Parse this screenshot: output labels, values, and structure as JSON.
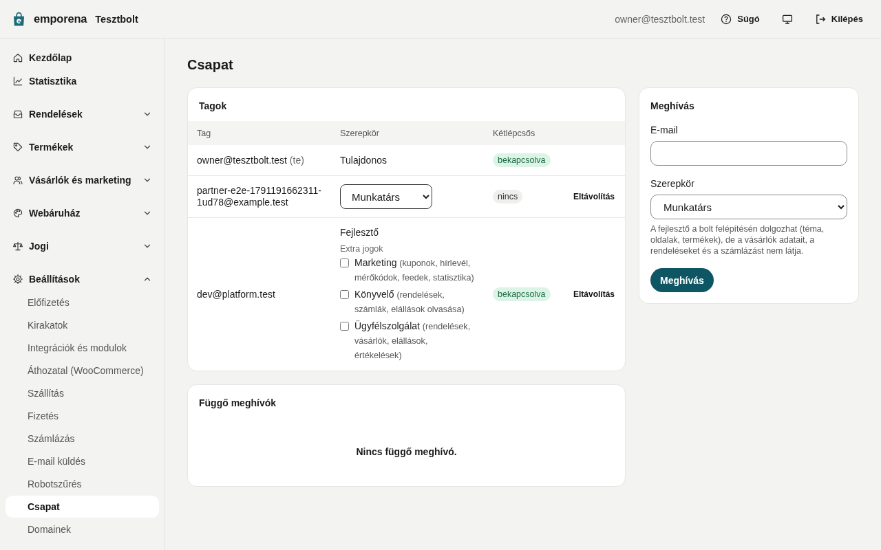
{
  "header": {
    "brand": "emporena",
    "store": "Tesztbolt",
    "user_email": "owner@tesztbolt.test",
    "actions": [
      {
        "kind": "help",
        "label": "Súgó"
      },
      {
        "kind": "display"
      },
      {
        "kind": "logout",
        "label": "Kilépés"
      }
    ]
  },
  "sidebar": {
    "items": [
      {
        "kind": "link",
        "label": "Kezdőlap",
        "selected": false
      },
      {
        "kind": "link",
        "label": "Statisztika",
        "selected": false
      },
      {
        "kind": "group",
        "label": "Rendelések",
        "expanded": false
      },
      {
        "kind": "group",
        "label": "Termékek",
        "expanded": false
      },
      {
        "kind": "group",
        "label": "Vásárlók és marketing",
        "expanded": false
      },
      {
        "kind": "group",
        "label": "Webáruház",
        "expanded": false
      },
      {
        "kind": "group",
        "label": "Jogi",
        "expanded": false
      },
      {
        "kind": "group",
        "label": "Beállítások",
        "expanded": true,
        "children": [
          {
            "label": "Előfizetés",
            "selected": false
          },
          {
            "label": "Kirakatok",
            "selected": false
          },
          {
            "label": "Integrációk és modulok",
            "selected": false
          },
          {
            "label": "Áthozatal (WooCommerce)",
            "selected": false
          },
          {
            "label": "Szállítás",
            "selected": false
          },
          {
            "label": "Fizetés",
            "selected": false
          },
          {
            "label": "Számlázás",
            "selected": false
          },
          {
            "label": "E-mail küldés",
            "selected": false
          },
          {
            "label": "Robotszűrés",
            "selected": false
          },
          {
            "label": "Csapat",
            "selected": true
          },
          {
            "label": "Domainek",
            "selected": false
          }
        ]
      }
    ]
  },
  "page": {
    "title": "Csapat"
  },
  "members": {
    "title": "Tagok",
    "columns": [
      "Tag",
      "Szerepkör",
      "Kétlépcsős"
    ],
    "rows": [
      {
        "member": "owner@tesztbolt.test",
        "member_note": "(te)",
        "role": {
          "kind": "text",
          "label": "Tulajdonos"
        },
        "two_factor": {
          "label": "bekapcsolva",
          "enabled": true
        }
      },
      {
        "member": "partner-e2e-1791191662311-1ud78@example.test",
        "role": {
          "kind": "select",
          "value": "Munkatárs"
        },
        "two_factor": {
          "label": "nincs",
          "enabled": false
        },
        "action": "Eltávolítás"
      },
      {
        "member": "dev@platform.test",
        "role": {
          "kind": "permissions",
          "label": "Fejlesztő",
          "extra_label": "Extra jogok",
          "permissions": [
            {
              "name": "Marketing",
              "detail": "(kuponok, hírlevél, mérőkódok, feedek, statisztika)",
              "checked": false
            },
            {
              "name": "Könyvelő",
              "detail": "(rendelések, számlák, elállások olvasása)",
              "checked": false
            },
            {
              "name": "Ügyfélszolgálat",
              "detail": "(rendelések, vásárlók, elállások, értékelések)",
              "checked": false
            }
          ]
        },
        "two_factor": {
          "label": "bekapcsolva",
          "enabled": true
        },
        "action": "Eltávolítás"
      }
    ]
  },
  "invite": {
    "title": "Meghívás",
    "email_label": "E-mail",
    "role_label": "Szerepkör",
    "role_value": "Munkatárs",
    "hint": "A fejlesztő a bolt felépítésén dolgozhat (téma, oldalak, termékek), de a vásárlók adatait, a rendeléseket és a számlázást nem látja.",
    "button": "Meghívás"
  },
  "pending_invites": {
    "title": "Függő meghívók",
    "empty_text": "Nincs függő meghívó."
  }
}
